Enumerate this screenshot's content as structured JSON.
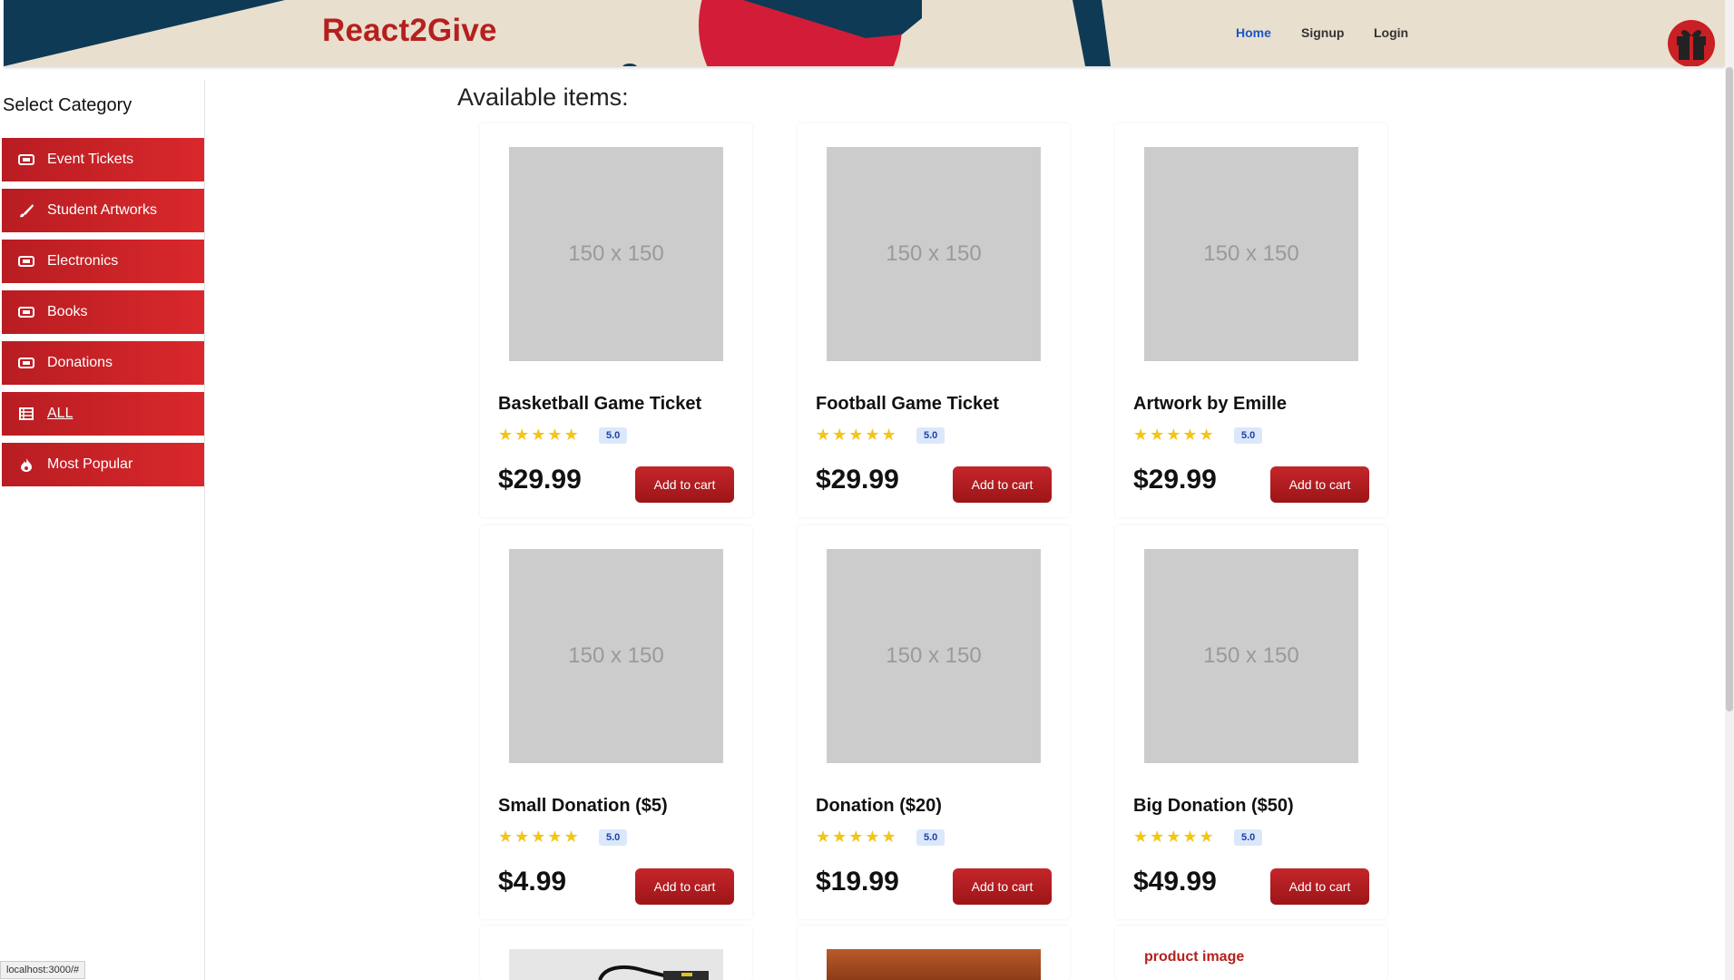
{
  "header": {
    "brand": "React2Give",
    "nav": [
      "Home",
      "Signup",
      "Login"
    ]
  },
  "sidebar": {
    "title": "Select Category",
    "items": [
      {
        "label": "Event Tickets",
        "icon": "ticket-icon"
      },
      {
        "label": "Student Artworks",
        "icon": "paintbrush-icon"
      },
      {
        "label": "Electronics",
        "icon": "ticket-icon"
      },
      {
        "label": "Books",
        "icon": "ticket-icon"
      },
      {
        "label": "Donations",
        "icon": "ticket-icon"
      },
      {
        "label": "ALL",
        "icon": "table-icon"
      },
      {
        "label": "Most Popular",
        "icon": "fire-icon"
      }
    ]
  },
  "main": {
    "title": "Available items:",
    "placeholder_text": "150 x 150",
    "stars": "★★★★★",
    "add_label": "Add to cart",
    "products": [
      {
        "name": "Basketball Game Ticket",
        "rating": "5.0",
        "price": "$29.99"
      },
      {
        "name": "Football Game Ticket",
        "rating": "5.0",
        "price": "$29.99"
      },
      {
        "name": "Artwork by Emille",
        "rating": "5.0",
        "price": "$29.99"
      },
      {
        "name": "Small Donation ($5)",
        "rating": "5.0",
        "price": "$4.99"
      },
      {
        "name": "Donation ($20)",
        "rating": "5.0",
        "price": "$19.99"
      },
      {
        "name": "Big Donation ($50)",
        "rating": "5.0",
        "price": "$49.99"
      }
    ],
    "broken_image_alt": "product image"
  },
  "status_bar": "localhost:3000/#",
  "colors": {
    "accent": "#d9282c",
    "header_bg": "#e9dfce",
    "navy": "#0e3a55",
    "rating_bg": "#dbe8fb",
    "star": "#f3c515"
  }
}
